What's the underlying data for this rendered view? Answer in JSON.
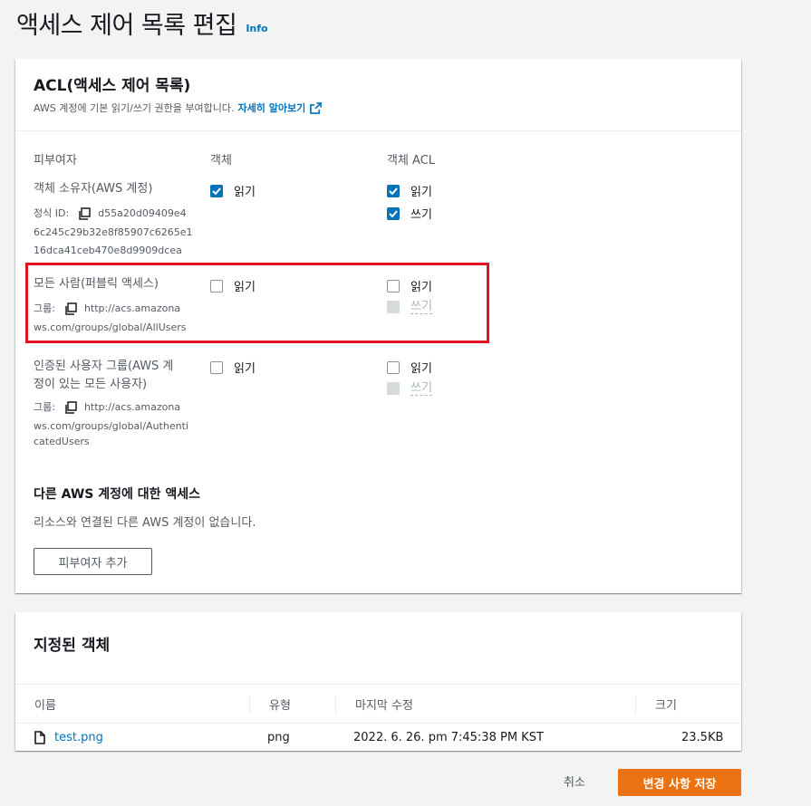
{
  "page": {
    "title": "액세스 제어 목록 편집",
    "info_link": "Info"
  },
  "acl": {
    "title": "ACL(액세스 제어 목록)",
    "description": "AWS 계정에 기본 읽기/쓰기 권한을 부여합니다.",
    "learn_more": "자세히 알아보기",
    "columns": {
      "grantee": "피부여자",
      "objects": "객체",
      "object_acl": "객체 ACL"
    },
    "grantees": [
      {
        "name": "객체 소유자(AWS 계정)",
        "id_label": "정식 ID:",
        "id_lines": [
          "d55a20d09409e4",
          "6c245c29b32e8f85907c6265e1",
          "16dca41ceb470e8d9909dcea"
        ],
        "objects_read": {
          "label": "읽기",
          "checked": true
        },
        "acl_read": {
          "label": "읽기",
          "checked": true
        },
        "acl_write": {
          "label": "쓰기",
          "checked": true
        }
      },
      {
        "name": "모든 사람(퍼블릭 액세스)",
        "group_label": "그룹:",
        "group_lines": [
          "http://acs.amazona",
          "ws.com/groups/global/AllUsers"
        ],
        "objects_read": {
          "label": "읽기",
          "checked": false
        },
        "acl_read": {
          "label": "읽기",
          "checked": false
        },
        "acl_write": {
          "label": "쓰기",
          "checked": false,
          "disabled": true
        }
      },
      {
        "name_lines": [
          "인증된 사용자 그룹(AWS 계",
          "정이 있는 모든 사용자)"
        ],
        "group_label": "그룹:",
        "group_lines": [
          "http://acs.amazona",
          "ws.com/groups/global/Authenti",
          "catedUsers"
        ],
        "objects_read": {
          "label": "읽기",
          "checked": false
        },
        "acl_read": {
          "label": "읽기",
          "checked": false
        },
        "acl_write": {
          "label": "쓰기",
          "checked": false,
          "disabled": true
        }
      }
    ],
    "other_accounts": {
      "title": "다른 AWS 계정에 대한 액세스",
      "empty": "리소스와 연결된 다른 AWS 계정이 없습니다.",
      "add_button": "피부여자 추가"
    }
  },
  "objects": {
    "title": "지정된 객체",
    "columns": [
      "이름",
      "유형",
      "마지막 수정",
      "크기"
    ],
    "rows": [
      {
        "name": "test.png",
        "type": "png",
        "modified": "2022. 6. 26. pm 7:45:38 PM KST",
        "size": "23.5KB",
        "icon": "file-icon"
      }
    ]
  },
  "footer": {
    "cancel": "취소",
    "save": "변경 사항 저장"
  },
  "colors": {
    "accent": "#0073bb",
    "primary": "#ec7211",
    "highlight": "#e0141e"
  }
}
